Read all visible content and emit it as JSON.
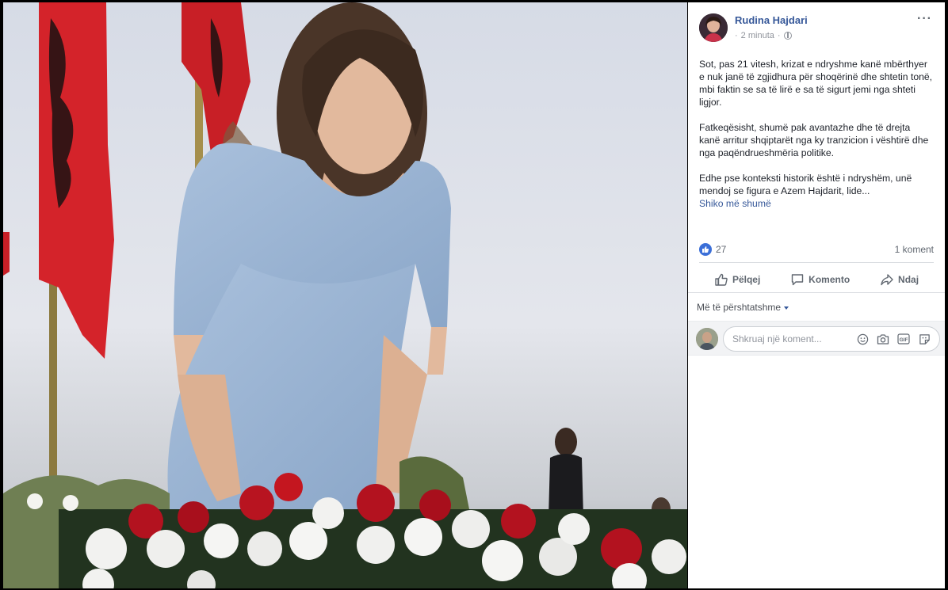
{
  "post": {
    "author": "Rudina Hajdari",
    "time": "2 minuta",
    "separator": "·",
    "paragraphs": [
      "Sot, pas 21 vitesh, krizat e ndryshme kanë mbërthyer e nuk janë të zgjidhura për shoqërinë dhe shtetin tonë, mbi faktin se sa të lirë e sa të sigurt jemi nga shteti ligjor.",
      "Fatkeqësisht, shumë pak avantazhe dhe të drejta kanë arritur shqiptarët nga ky tranzicion i vështirë dhe nga paqëndrueshmëria politike.",
      "Edhe pse konteksti historik është i ndryshëm, unë mendoj se figura e Azem Hajdarit, lide..."
    ],
    "see_more": "Shiko më shumë",
    "like_count": "27",
    "comment_count": "1 koment",
    "privacy_icon": "globe-icon",
    "more_icon": "more-options-icon"
  },
  "actions": {
    "like": "Pëlqej",
    "comment": "Komento",
    "share": "Ndaj"
  },
  "comments": {
    "sort_label": "Më të përshtatshme",
    "input_placeholder": "Shkruaj një koment..."
  },
  "colors": {
    "link": "#365899",
    "like_blue": "#3b6fd8",
    "flag_red": "#d4232a"
  }
}
